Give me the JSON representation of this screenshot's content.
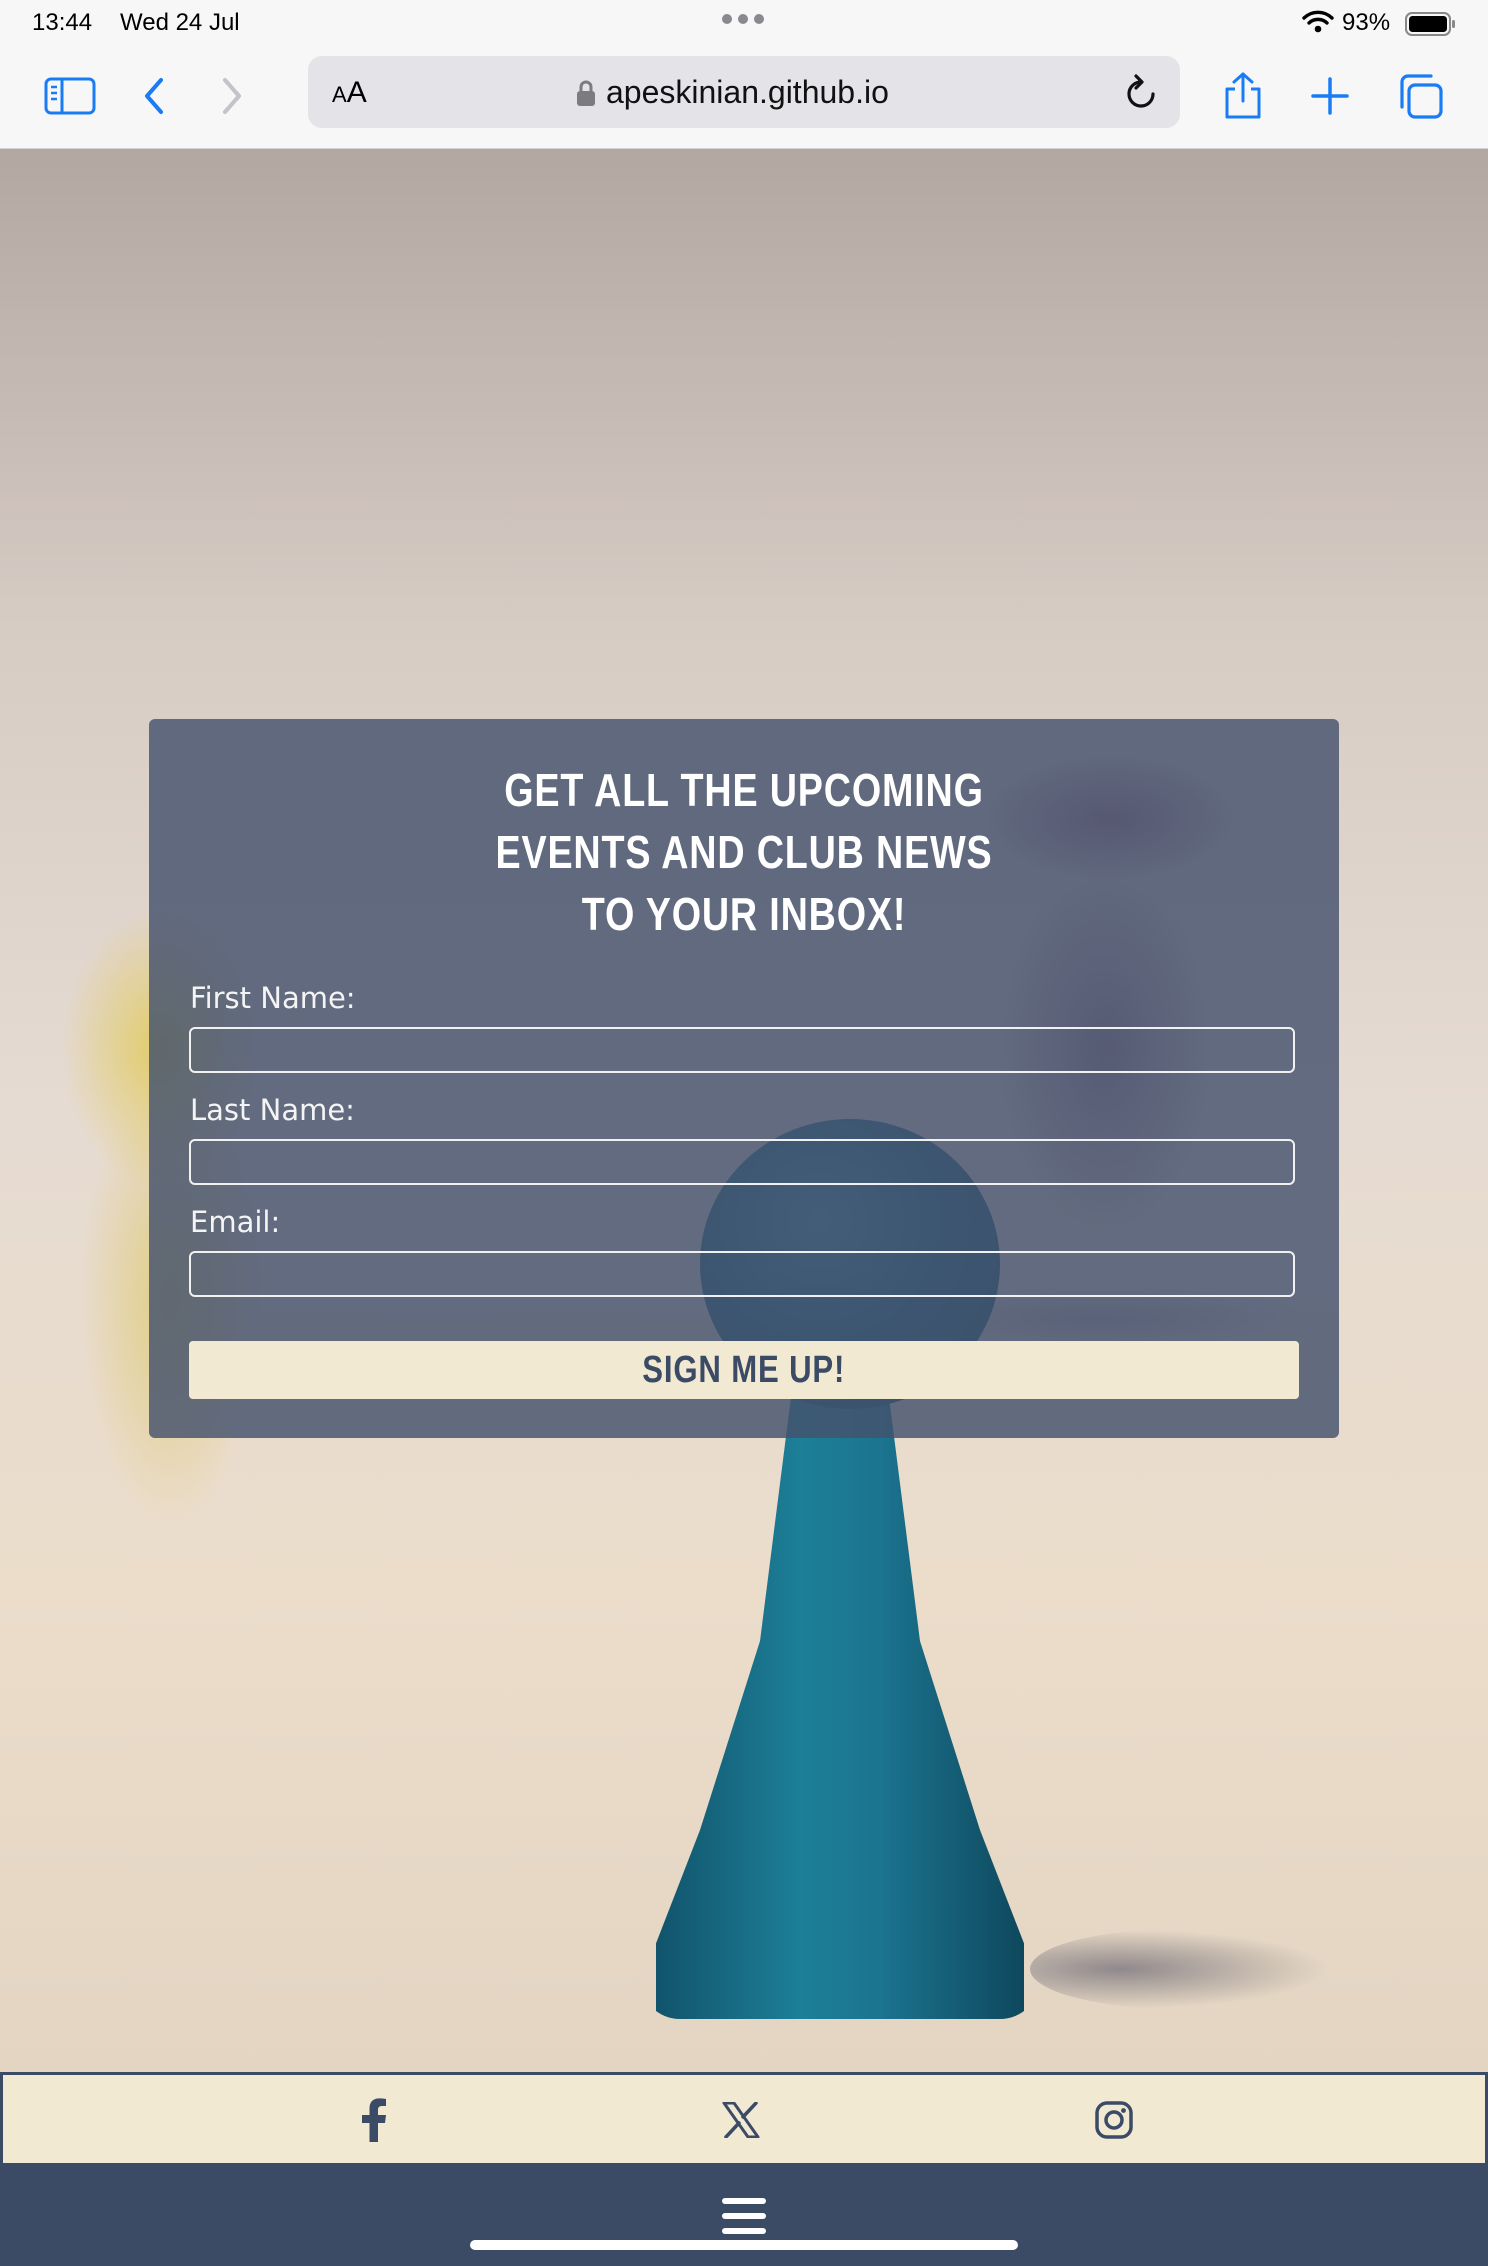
{
  "status_bar": {
    "time": "13:44",
    "date": "Wed 24 Jul",
    "battery": "93%",
    "icons": [
      "wifi-icon",
      "battery-icon",
      "multitasking-dots-icon"
    ]
  },
  "browser": {
    "text_size_button": {
      "small": "A",
      "big": "A"
    },
    "url": "apeskinian.github.io",
    "icons": [
      "sidebar-icon",
      "back-icon",
      "forward-icon",
      "lock-icon",
      "reload-icon",
      "share-icon",
      "new-tab-icon",
      "tabs-icon"
    ],
    "accent_color": "#1a7cf5"
  },
  "signup": {
    "heading_lines": [
      "GET ALL THE UPCOMING",
      "EVENTS AND CLUB NEWS",
      "TO YOUR INBOX!"
    ],
    "first_name_label": "First Name:",
    "first_name_value": "",
    "last_name_label": "Last Name:",
    "last_name_value": "",
    "email_label": "Email:",
    "email_value": "",
    "submit_label": "SIGN ME UP!"
  },
  "footer": {
    "social_icons": [
      "facebook-icon",
      "x-icon",
      "instagram-icon"
    ],
    "menu_icon": "hamburger-menu-icon"
  },
  "colors": {
    "navy": "#3b4b66",
    "cream": "#f1e9d2",
    "card_overlay": "#44526c"
  }
}
